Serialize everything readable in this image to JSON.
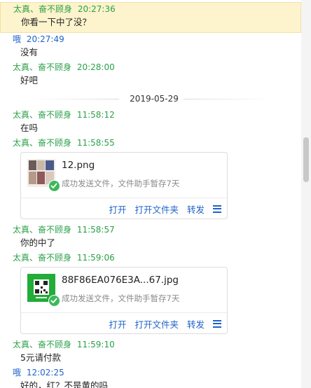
{
  "messages_a": [
    {
      "sender": "太真、奋不顾身",
      "time": "20:27:36",
      "text": "你看一下中了没？",
      "role": "peer",
      "highlight": true
    },
    {
      "sender": "哦",
      "time": "20:27:49",
      "text": "没有",
      "role": "me"
    },
    {
      "sender": "太真、奋不顾身",
      "time": "20:28:00",
      "text": "好吧",
      "role": "peer"
    }
  ],
  "date_separator": "2019-05-29",
  "messages_b": [
    {
      "sender": "太真、奋不顾身",
      "time": "11:58:12",
      "text": "在吗",
      "role": "peer"
    },
    {
      "sender": "太真、奋不顾身",
      "time": "11:58:55",
      "role": "peer",
      "file": {
        "name": "12.png",
        "status": "成功发送文件，文件助手暂存7天",
        "thumb": "photo-collage-thumbnail"
      }
    },
    {
      "sender": "太真、奋不顾身",
      "time": "11:58:57",
      "text": "你的中了",
      "role": "peer"
    },
    {
      "sender": "太真、奋不顾身",
      "time": "11:59:06",
      "role": "peer",
      "file": {
        "name": "88F86EA076E3A...67.jpg",
        "status": "成功发送文件，文件助手暂存7天",
        "thumb": "wechat-pay-qr-thumbnail"
      }
    },
    {
      "sender": "太真、奋不顾身",
      "time": "11:59:10",
      "text": "5元请付款",
      "role": "peer"
    },
    {
      "sender": "哦",
      "time": "12:02:25",
      "text": "好的，红？不是黄的吗",
      "role": "me"
    }
  ],
  "file_actions": {
    "open": "打开",
    "open_folder": "打开文件夹",
    "forward": "转发",
    "more_icon": "menu-icon"
  },
  "colors": {
    "peer_name": "#2aa148",
    "self_name": "#1e63c8",
    "link": "#1e63c8",
    "highlight_bg": "#fdf3cc"
  }
}
